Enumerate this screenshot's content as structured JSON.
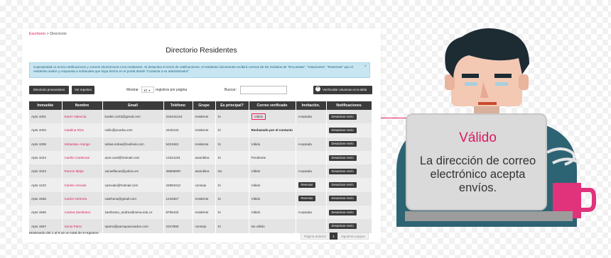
{
  "breadcrumb": {
    "link": "Escritorio",
    "separator": ">",
    "current": "Directorio"
  },
  "page_title": "Directorio Residentes",
  "alert": {
    "text": "Copropiedad.co envía notificaciones y correos electrónicos a los residentes. Si desactiva el envío de notificaciones, el residente únicamente recibirá correos de los módulos de \"Encuestas\", \"Votaciones\", \"Reservas\" que el residente realice y respuesta a solicitudes que haya hecho en el portal desde \"Contacte a su administrador\".",
    "close": "×"
  },
  "toolbar": {
    "providers_button": "Directorio proveedores",
    "reports_button": "Ver reportes",
    "show_label": "Mostrar",
    "show_value": "10",
    "per_page_label": "registros por página",
    "search_label": "Buscar:",
    "toggle_columns_button": "Ver/Ocultar columnas en la tabla",
    "toggle_icon": "+"
  },
  "table": {
    "headers": [
      "Inmueble",
      "Nombre",
      "Email",
      "Teléfono",
      "Grupo",
      "Es principal?",
      "Correo verificado",
      "Invitación.",
      "Notificaciones"
    ],
    "rows": [
      {
        "inmueble": "Apto 1001",
        "nombre": "Karen Valencia",
        "email": "kvalen.1243@gmail.com",
        "telefono": "315415134",
        "grupo": "residente",
        "principal": "Si",
        "correo": "Válido",
        "invitacion": "Aceptada",
        "notif": "Desactivar envío",
        "reenviar": ""
      },
      {
        "inmueble": "Apto 1004",
        "nombre": "Catalina Rios",
        "email": "csilio@prueba.com",
        "telefono": "4445134",
        "grupo": "residente",
        "principal": "Si",
        "correo": "Rechazado por el contacto",
        "invitacion": "",
        "notif": "Desactivar envío",
        "reenviar": ""
      },
      {
        "inmueble": "Apto 1006",
        "nombre": "Sebastian Arango",
        "email": "sebas.sebas@outlook.com",
        "telefono": "5423462",
        "grupo": "residente",
        "principal": "Si",
        "correo": "Válido",
        "invitacion": "Aceptada",
        "notif": "Desactivar envío",
        "reenviar": ""
      },
      {
        "inmueble": "Apto 1024",
        "nombre": "Aurelio Cardenas",
        "email": "aure.card@hotmail.com",
        "telefono": "12341231",
        "grupo": "asamblea",
        "principal": "Si",
        "correo": "Pendiente",
        "invitacion": "",
        "notif": "Desactivar envío",
        "reenviar": ""
      },
      {
        "inmueble": "Apto 1024",
        "nombre": "Ramon Mejia",
        "email": "vacasflacas@yahoo.es",
        "telefono": "49856800",
        "grupo": "asamblea",
        "principal": "No",
        "correo": "Válido",
        "invitacion": "Aceptada",
        "notif": "Desactivar envío",
        "reenviar": ""
      },
      {
        "inmueble": "Apto 1222",
        "nombre": "Camilo Arevalo",
        "email": "carevalo@hotmail.com",
        "telefono": "24891012",
        "grupo": "consejo",
        "principal": "Si",
        "correo": "Válido",
        "invitacion": "",
        "notif": "Desactivar envío",
        "reenviar": "Reenviar"
      },
      {
        "inmueble": "Apto 1555",
        "nombre": "Carlos Atehorta",
        "email": "cateho​na@gmail.com",
        "telefono": "1234567",
        "grupo": "residente",
        "principal": "Si",
        "correo": "Válido",
        "invitacion": "",
        "notif": "Desactivar envío",
        "reenviar": "Reenviar"
      },
      {
        "inmueble": "Apto 1556",
        "nombre": "Andrea Zambrano",
        "email": "zambrano_andrea@sena.edu.co",
        "telefono": "8765432",
        "grupo": "residente",
        "principal": "Si",
        "correo": "Válido",
        "invitacion": "Aceptada",
        "notif": "Desactivar envío",
        "reenviar": ""
      },
      {
        "inmueble": "Apto 1557",
        "nombre": "Sonia Parra",
        "email": "sparra@parrayasociados.com",
        "telefono": "2347890",
        "grupo": "consejo",
        "principal": "Si",
        "correo": "No válido",
        "invitacion": "",
        "notif": "Desactivar envío",
        "reenviar": ""
      }
    ]
  },
  "footer": {
    "summary": "Mostrando del 1 al 9 de un total de 9 registros",
    "prev": "Página anterior",
    "page": "1",
    "next": "Siguiente página"
  },
  "callout": {
    "title": "Válido",
    "text": "La dirección de correo electrónico acepta envíos."
  },
  "colors": {
    "accent": "#d81b60",
    "dark_button": "#3b3b3b",
    "alert_bg": "#c8e6f2"
  }
}
